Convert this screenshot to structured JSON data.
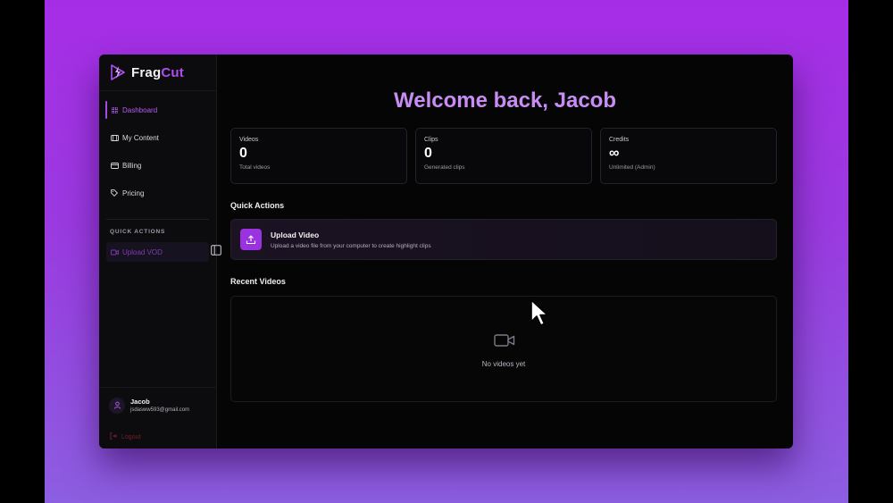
{
  "app": {
    "brand_primary": "Frag",
    "brand_accent": "Cut",
    "accent_color": "#b04df0"
  },
  "sidebar": {
    "items": [
      {
        "label": "Dashboard",
        "icon": "grid-icon",
        "active": true
      },
      {
        "label": "My Content",
        "icon": "film-icon",
        "active": false
      },
      {
        "label": "Billing",
        "icon": "card-icon",
        "active": false
      },
      {
        "label": "Pricing",
        "icon": "tag-icon",
        "active": false
      }
    ],
    "quick_actions_label": "QUICK ACTIONS",
    "upload_label": "Upload VOD",
    "user": {
      "name": "Jacob",
      "email": "jsdasww593@gmail.com"
    },
    "logout_label": "Logout"
  },
  "main": {
    "welcome": "Welcome back, Jacob",
    "stats": [
      {
        "label": "Videos",
        "value": "0",
        "sub": "Total videos"
      },
      {
        "label": "Clips",
        "value": "0",
        "sub": "Generated clips"
      },
      {
        "label": "Credits",
        "value": "∞",
        "sub": "Unlimited (Admin)"
      }
    ],
    "quick_actions_title": "Quick Actions",
    "quick_action": {
      "title": "Upload Video",
      "description": "Upload a video file from your computer to create highlight clips"
    },
    "recent_title": "Recent Videos",
    "empty_text": "No videos yet"
  }
}
